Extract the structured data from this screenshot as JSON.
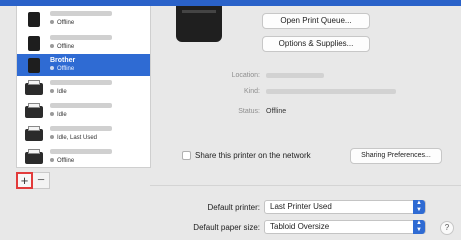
{
  "printers": [
    {
      "name": "",
      "status": "Offline",
      "status_color": "#9a9a9a",
      "selected": false
    },
    {
      "name": "",
      "status": "Offline",
      "status_color": "#9a9a9a",
      "selected": false
    },
    {
      "name": "Brother",
      "status": "Offline",
      "status_color": "#9a9a9a",
      "selected": true
    },
    {
      "name": "",
      "status": "Idle",
      "status_color": "#9a9a9a",
      "selected": false
    },
    {
      "name": "",
      "status": "Idle",
      "status_color": "#9a9a9a",
      "selected": false
    },
    {
      "name": "",
      "status": "Idle, Last Used",
      "status_color": "#9a9a9a",
      "selected": false
    },
    {
      "name": "",
      "status": "Offline",
      "status_color": "#9a9a9a",
      "selected": false
    }
  ],
  "list_controls": {
    "add": "+",
    "remove": "−"
  },
  "buttons": {
    "open_print_queue": "Open Print Queue...",
    "options_supplies": "Options & Supplies..."
  },
  "info": {
    "location_label": "Location:",
    "kind_label": "Kind:",
    "status_label": "Status:",
    "status_value": "Offline"
  },
  "share": {
    "label": "Share this printer on the network",
    "checked": false,
    "sharing_prefs_button": "Sharing Preferences..."
  },
  "defaults": {
    "printer_label": "Default printer:",
    "printer_value": "Last Printer Used",
    "paper_label": "Default paper size:",
    "paper_value": "Tabloid Oversize"
  },
  "help": "?",
  "colors": {
    "accent": "#2f6bd3",
    "highlight_border": "#e23b3b"
  }
}
